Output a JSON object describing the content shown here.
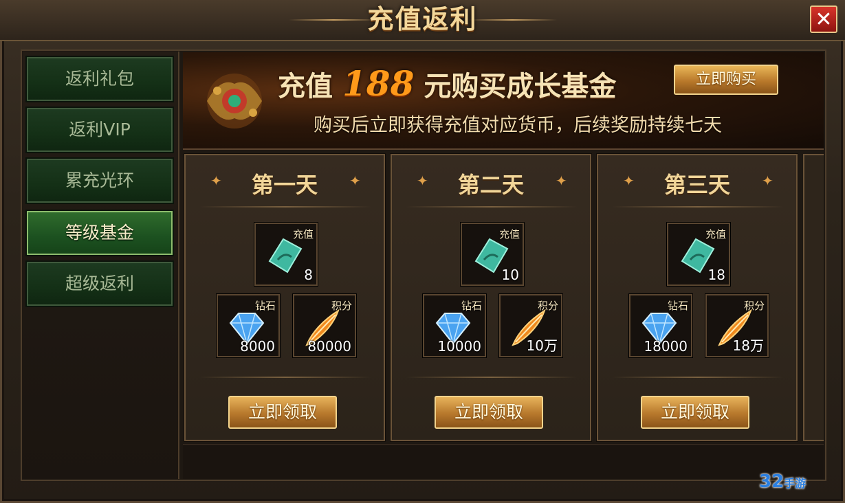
{
  "window": {
    "title": "充值返利",
    "close_label": "✕"
  },
  "sidebar": {
    "items": [
      {
        "label": "返利礼包",
        "active": false
      },
      {
        "label": "返利VIP",
        "active": false
      },
      {
        "label": "累充光环",
        "active": false
      },
      {
        "label": "等级基金",
        "active": true
      },
      {
        "label": "超级返利",
        "active": false
      }
    ]
  },
  "banner": {
    "prefix": "充值",
    "amount": "188",
    "suffix": "元购买成长基金",
    "subtitle": "购买后立即获得充值对应货币，后续奖励持续七天",
    "buy_label": "立即购买"
  },
  "days": [
    {
      "title": "第一天",
      "rewards": [
        {
          "tag": "充值",
          "qty": "8",
          "icon": "jade-token-icon"
        },
        {
          "tag": "钻石",
          "qty": "8000",
          "icon": "diamond-icon"
        },
        {
          "tag": "积分",
          "qty": "80000",
          "icon": "phoenix-feather-icon"
        }
      ],
      "claim_label": "立即领取"
    },
    {
      "title": "第二天",
      "rewards": [
        {
          "tag": "充值",
          "qty": "10",
          "icon": "jade-token-icon"
        },
        {
          "tag": "钻石",
          "qty": "10000",
          "icon": "diamond-icon"
        },
        {
          "tag": "积分",
          "qty": "10万",
          "icon": "phoenix-feather-icon"
        }
      ],
      "claim_label": "立即领取"
    },
    {
      "title": "第三天",
      "rewards": [
        {
          "tag": "充值",
          "qty": "18",
          "icon": "jade-token-icon"
        },
        {
          "tag": "钻石",
          "qty": "18000",
          "icon": "diamond-icon"
        },
        {
          "tag": "积分",
          "qty": "18万",
          "icon": "phoenix-feather-icon"
        }
      ],
      "claim_label": "立即领取"
    }
  ],
  "watermark": {
    "text": "32",
    "sub": "手游"
  },
  "colors": {
    "gold": "#f1d598",
    "active_tab": "#2f6b2c",
    "button_gold": "#e7b25a",
    "close_red": "#d8342a"
  }
}
